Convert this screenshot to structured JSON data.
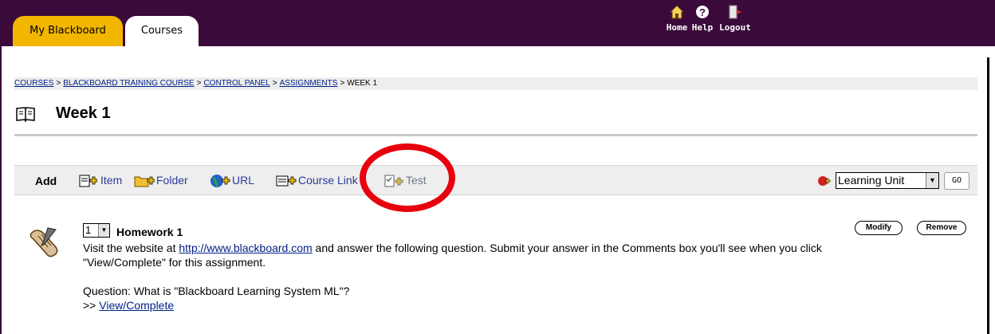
{
  "tabs": [
    {
      "label": "My Blackboard"
    },
    {
      "label": "Courses"
    }
  ],
  "top_links": {
    "home": "Home",
    "help": "Help",
    "logout": "Logout"
  },
  "breadcrumb": {
    "items": [
      "COURSES",
      "BLACKBOARD TRAINING COURSE",
      "CONTROL PANEL",
      "ASSIGNMENTS"
    ],
    "separator": ">",
    "current": "WEEK 1"
  },
  "page_title": "Week 1",
  "action_bar": {
    "add_label": "Add",
    "items": [
      {
        "label": "Item",
        "icon": "item-icon"
      },
      {
        "label": "Folder",
        "icon": "folder-icon"
      },
      {
        "label": "URL",
        "icon": "globe-icon"
      },
      {
        "label": "Course Link",
        "icon": "course-link-icon"
      },
      {
        "label": "Test",
        "icon": "test-icon"
      }
    ],
    "select_value": "Learning Unit",
    "go_label": "GO"
  },
  "content_item": {
    "order_value": "1",
    "title": "Homework 1",
    "line1_pre": "Visit the website at ",
    "link": "http://www.blackboard.com",
    "line1_post": " and answer the following question. Submit your answer in the Comments box you'll see when you click \"View/Complete\" for this assignment.",
    "question": "Question: What is \"Blackboard Learning System ML\"?",
    "view_prefix": ">> ",
    "view_link": "View/Complete",
    "modify_label": "Modify",
    "remove_label": "Remove"
  },
  "colors": {
    "topbar": "#3a0a3a",
    "tab_active": "#f2b600",
    "link": "#00208a",
    "annotation": "#e8000c"
  }
}
